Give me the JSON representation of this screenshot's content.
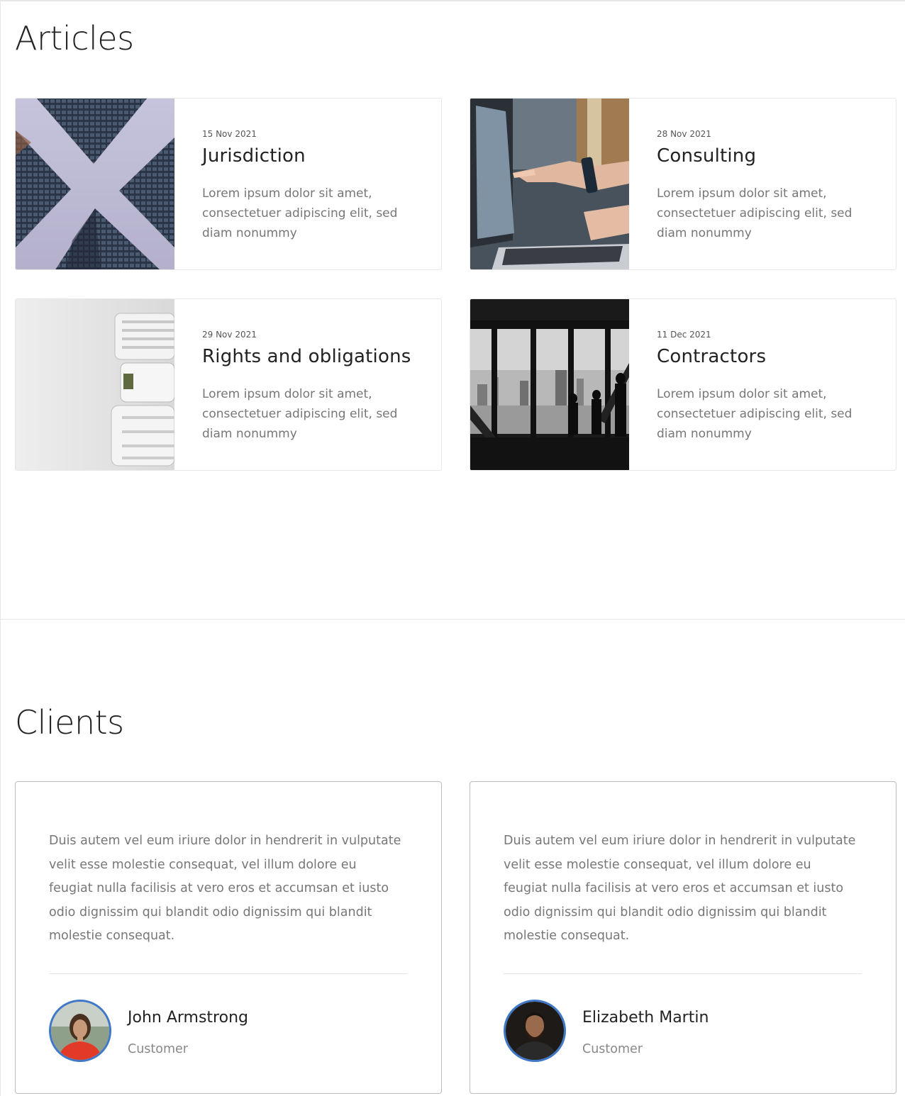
{
  "articles": {
    "title": "Articles",
    "items": [
      {
        "date": "15 Nov 2021",
        "title": "Jurisdiction",
        "excerpt": "Lorem ipsum dolor sit amet, consectetuer adipiscing elit, sed diam nonummy",
        "image": "skyscrapers-upward-photo"
      },
      {
        "date": "28 Nov 2021",
        "title": "Consulting",
        "excerpt": "Lorem ipsum dolor sit amet, consectetuer adipiscing elit, sed diam nonummy",
        "image": "laptop-pointing-hand-photo"
      },
      {
        "date": "29 Nov 2021",
        "title": "Rights and obligations",
        "excerpt": "Lorem ipsum dolor sit amet, consectetuer adipiscing elit, sed diam nonummy",
        "image": "stacked-binders-photo"
      },
      {
        "date": "11 Dec 2021",
        "title": "Contractors",
        "excerpt": "Lorem ipsum dolor sit amet, consectetuer adipiscing elit, sed diam nonummy",
        "image": "office-window-silhouettes-photo"
      }
    ]
  },
  "clients": {
    "title": "Clients",
    "items": [
      {
        "quote": "Duis autem vel eum iriure dolor in hendrerit in vulputate velit esse molestie consequat, vel illum dolore eu feugiat nulla facilisis at vero eros et accumsan et iusto odio dignissim qui blandit odio dignissim qui blandit molestie consequat.",
        "name": "John Armstrong",
        "role": "Customer",
        "avatar": "woman-red-top-avatar"
      },
      {
        "quote": "Duis autem vel eum iriure dolor in hendrerit in vulputate velit esse molestie consequat, vel illum dolore eu feugiat nulla facilisis at vero eros et accumsan et iusto odio dignissim qui blandit odio dignissim qui blandit molestie consequat.",
        "name": "Elizabeth Martin",
        "role": "Customer",
        "avatar": "bearded-man-avatar"
      }
    ]
  },
  "colors": {
    "avatar_border": "#3f78c8",
    "text_dark": "#222222",
    "text_muted": "#777777"
  }
}
